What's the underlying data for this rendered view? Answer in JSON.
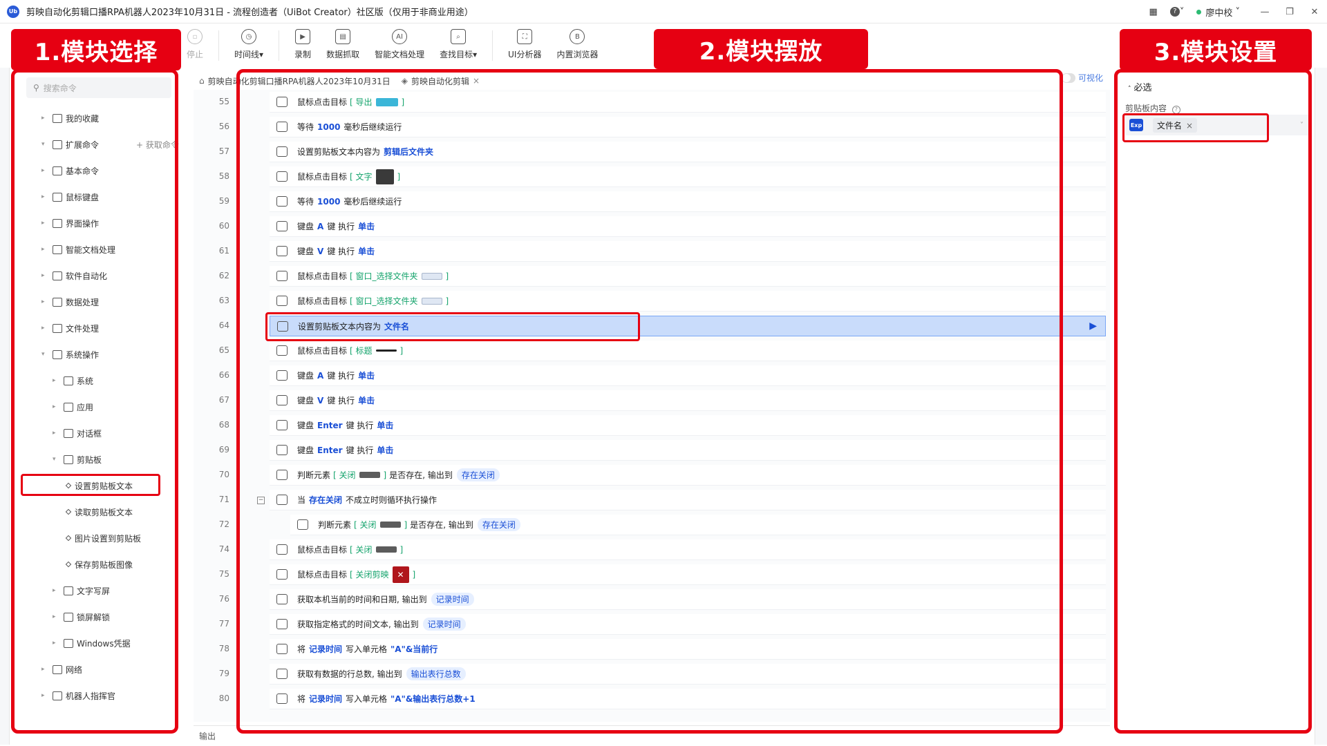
{
  "window": {
    "title": "剪映自动化剪辑口播RPA机器人2023年10月31日 - 流程创造者（UiBot Creator）社区版（仅用于非商业用途）",
    "logo_text": "Ub",
    "user": "廖中校",
    "help_label": "?",
    "layout_icon": "grid-icon"
  },
  "toolbar": {
    "stop": "停止",
    "timeline": "时间线▾",
    "record": "录制",
    "data_grab": "数据抓取",
    "smart_doc": "智能文档处理",
    "find_target": "查找目标▾",
    "ui_analyzer": "UI分析器",
    "browser": "内置浏览器"
  },
  "headers": {
    "left": "1.模块选择",
    "middle": "2.模块摆放",
    "right": "3.模块设置"
  },
  "left_panel": {
    "search_placeholder": "搜索命令",
    "get_cmd": "获取命令",
    "tree": [
      {
        "label": "我的收藏",
        "level": 0,
        "arrow": "▸"
      },
      {
        "label": "扩展命令",
        "level": 0,
        "arrow": "▾"
      },
      {
        "label": "基本命令",
        "level": 0,
        "arrow": "▸"
      },
      {
        "label": "鼠标键盘",
        "level": 0,
        "arrow": "▸"
      },
      {
        "label": "界面操作",
        "level": 0,
        "arrow": "▸"
      },
      {
        "label": "智能文档处理",
        "level": 0,
        "arrow": "▸"
      },
      {
        "label": "软件自动化",
        "level": 0,
        "arrow": "▸"
      },
      {
        "label": "数据处理",
        "level": 0,
        "arrow": "▸"
      },
      {
        "label": "文件处理",
        "level": 0,
        "arrow": "▸"
      },
      {
        "label": "系统操作",
        "level": 0,
        "arrow": "▾"
      },
      {
        "label": "系统",
        "level": 1,
        "arrow": "▸"
      },
      {
        "label": "应用",
        "level": 1,
        "arrow": "▸"
      },
      {
        "label": "对话框",
        "level": 1,
        "arrow": "▸"
      },
      {
        "label": "剪贴板",
        "level": 1,
        "arrow": "▾"
      },
      {
        "label": "设置剪贴板文本",
        "level": 2,
        "arrow": ""
      },
      {
        "label": "读取剪贴板文本",
        "level": 2,
        "arrow": ""
      },
      {
        "label": "图片设置到剪贴板",
        "level": 2,
        "arrow": ""
      },
      {
        "label": "保存剪贴板图像",
        "level": 2,
        "arrow": ""
      },
      {
        "label": "文字写屏",
        "level": 1,
        "arrow": "▸"
      },
      {
        "label": "锁屏解锁",
        "level": 1,
        "arrow": "▸"
      },
      {
        "label": "Windows凭据",
        "level": 1,
        "arrow": "▸"
      },
      {
        "label": "网络",
        "level": 0,
        "arrow": "▸"
      },
      {
        "label": "机器人指挥官",
        "level": 0,
        "arrow": "▸"
      }
    ]
  },
  "tabs": [
    {
      "label": "剪映自动化剪辑口播RPA机器人2023年10月31日"
    },
    {
      "label": "剪映自动化剪辑",
      "close": "×"
    }
  ],
  "visualize_label": "可视化",
  "output_label": "输出",
  "lines": [
    {
      "n": "55",
      "parts": [
        [
          "t",
          "鼠标点击目标"
        ],
        [
          "g",
          "[ 导出"
        ],
        [
          "chip",
          "blue"
        ],
        [
          "g",
          "]"
        ]
      ]
    },
    {
      "n": "56",
      "parts": [
        [
          "t",
          "等待"
        ],
        [
          "k",
          "1000"
        ],
        [
          "t",
          "毫秒后继续运行"
        ]
      ]
    },
    {
      "n": "57",
      "parts": [
        [
          "t",
          "设置剪贴板文本内容为"
        ],
        [
          "k",
          "剪辑后文件夹"
        ]
      ]
    },
    {
      "n": "58",
      "parts": [
        [
          "t",
          "鼠标点击目标"
        ],
        [
          "g",
          "[ 文字"
        ],
        [
          "chip",
          "folder"
        ],
        [
          "g",
          "]"
        ]
      ]
    },
    {
      "n": "59",
      "parts": [
        [
          "t",
          "等待"
        ],
        [
          "k",
          "1000"
        ],
        [
          "t",
          "毫秒后继续运行"
        ]
      ]
    },
    {
      "n": "60",
      "parts": [
        [
          "t",
          "键盘"
        ],
        [
          "k",
          "A"
        ],
        [
          "t",
          "键 执行"
        ],
        [
          "k",
          "单击"
        ]
      ]
    },
    {
      "n": "61",
      "parts": [
        [
          "t",
          "键盘"
        ],
        [
          "k",
          "V"
        ],
        [
          "t",
          "键 执行"
        ],
        [
          "k",
          "单击"
        ]
      ]
    },
    {
      "n": "62",
      "parts": [
        [
          "t",
          "鼠标点击目标"
        ],
        [
          "g",
          "[ 窗口_选择文件夹"
        ],
        [
          "chip",
          "light"
        ],
        [
          "g",
          "]"
        ]
      ]
    },
    {
      "n": "63",
      "parts": [
        [
          "t",
          "鼠标点击目标"
        ],
        [
          "g",
          "[ 窗口_选择文件夹"
        ],
        [
          "chip",
          "light"
        ],
        [
          "g",
          "]"
        ]
      ]
    },
    {
      "n": "64",
      "selected": true,
      "parts": [
        [
          "t",
          "设置剪贴板文本内容为"
        ],
        [
          "k",
          "文件名"
        ]
      ]
    },
    {
      "n": "65",
      "parts": [
        [
          "t",
          "鼠标点击目标"
        ],
        [
          "g",
          "[ 标题"
        ],
        [
          "chip",
          "dark"
        ],
        [
          "g",
          "]"
        ]
      ]
    },
    {
      "n": "66",
      "parts": [
        [
          "t",
          "键盘"
        ],
        [
          "k",
          "A"
        ],
        [
          "t",
          "键 执行"
        ],
        [
          "k",
          "单击"
        ]
      ]
    },
    {
      "n": "67",
      "parts": [
        [
          "t",
          "键盘"
        ],
        [
          "k",
          "V"
        ],
        [
          "t",
          "键 执行"
        ],
        [
          "k",
          "单击"
        ]
      ]
    },
    {
      "n": "68",
      "parts": [
        [
          "t",
          "键盘"
        ],
        [
          "k",
          "Enter"
        ],
        [
          "t",
          "键 执行"
        ],
        [
          "k",
          "单击"
        ]
      ]
    },
    {
      "n": "69",
      "parts": [
        [
          "t",
          "键盘"
        ],
        [
          "k",
          "Enter"
        ],
        [
          "t",
          "键 执行"
        ],
        [
          "k",
          "单击"
        ]
      ]
    },
    {
      "n": "70",
      "parts": [
        [
          "t",
          "判断元素"
        ],
        [
          "g",
          "[ 关闭"
        ],
        [
          "chip",
          "gray"
        ],
        [
          "g",
          "]"
        ],
        [
          "t",
          "是否存在, 输出到"
        ],
        [
          "p",
          "存在关闭"
        ]
      ]
    },
    {
      "n": "71",
      "collapse": true,
      "parts": [
        [
          "t",
          "当"
        ],
        [
          "k",
          "存在关闭"
        ],
        [
          "t",
          "不成立时则循环执行操作"
        ]
      ]
    },
    {
      "n": "72",
      "indent": true,
      "parts": [
        [
          "t",
          "判断元素"
        ],
        [
          "g",
          "[ 关闭"
        ],
        [
          "chip",
          "gray"
        ],
        [
          "g",
          "]"
        ],
        [
          "t",
          "是否存在, 输出到"
        ],
        [
          "p",
          "存在关闭"
        ]
      ]
    },
    {
      "n": "74",
      "parts": [
        [
          "t",
          "鼠标点击目标"
        ],
        [
          "g",
          "[ 关闭"
        ],
        [
          "chip",
          "gray"
        ],
        [
          "g",
          "]"
        ]
      ]
    },
    {
      "n": "75",
      "parts": [
        [
          "t",
          "鼠标点击目标"
        ],
        [
          "g",
          "[ 关闭剪映"
        ],
        [
          "chip",
          "closeimg"
        ],
        [
          "g",
          "]"
        ]
      ]
    },
    {
      "n": "76",
      "parts": [
        [
          "t",
          "获取本机当前的时间和日期, 输出到"
        ],
        [
          "p",
          "记录时间"
        ]
      ]
    },
    {
      "n": "77",
      "parts": [
        [
          "t",
          "获取指定格式的时间文本, 输出到"
        ],
        [
          "p",
          "记录时间"
        ]
      ]
    },
    {
      "n": "78",
      "parts": [
        [
          "t",
          "将"
        ],
        [
          "k",
          "记录时间"
        ],
        [
          "t",
          "写入单元格"
        ],
        [
          "k",
          "\"A\"&当前行"
        ]
      ]
    },
    {
      "n": "79",
      "parts": [
        [
          "t",
          "获取有数据的行总数, 输出到"
        ],
        [
          "p",
          "输出表行总数"
        ]
      ]
    },
    {
      "n": "80",
      "parts": [
        [
          "t",
          "将"
        ],
        [
          "k",
          "记录时间"
        ],
        [
          "t",
          "写入单元格"
        ],
        [
          "k",
          "\"A\"&输出表行总数+1"
        ]
      ]
    }
  ],
  "right_panel": {
    "section": "必选",
    "field_label": "剪贴板内容",
    "help": "?",
    "exp_tag": "Exp",
    "value": "文件名",
    "value_close": "×"
  },
  "colors": {
    "accent_red": "#e60012",
    "keyword_blue": "#1a4fd6",
    "target_green": "#13a36b",
    "selected_row": "#c9dcfb"
  }
}
